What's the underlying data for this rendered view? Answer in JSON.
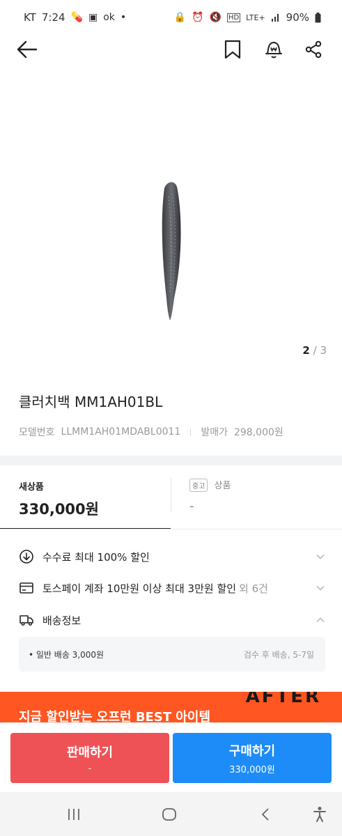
{
  "status_bar": {
    "carrier": "KT",
    "time": "7:24",
    "network": "LTE+",
    "battery": "90%"
  },
  "product": {
    "image_counter": {
      "current": "2",
      "separator": "/",
      "total": "3"
    },
    "title": "클러치백 MM1AH01BL",
    "model_label": "모델번호",
    "model_number": "LLMM1AH01MDABL0011",
    "release_label": "발매가",
    "release_price": "298,000원"
  },
  "price_tabs": {
    "new_label": "새상품",
    "new_price": "330,000원",
    "used_badge": "중고",
    "used_label": "상품",
    "used_price": "-"
  },
  "info_rows": {
    "fee": "수수료 최대 100% 할인",
    "tosspay": "토스페이 계좌 10만원 이상 최대 3만원 할인",
    "tosspay_extra": "외 6건",
    "shipping": "배송정보"
  },
  "shipping_detail": {
    "left": "• 일반 배송 3,000원",
    "right": "검수 후 배송, 5-7일"
  },
  "promo": {
    "text": "지금 할인받는 오프런 BEST 아이템",
    "art": "AFTER"
  },
  "actions": {
    "sell_label": "판매하기",
    "sell_sub": "-",
    "buy_label": "구매하기",
    "buy_price": "330,000원"
  },
  "colors": {
    "sell": "#ef5256",
    "buy": "#1d8cf8",
    "promo": "#ff5622"
  }
}
